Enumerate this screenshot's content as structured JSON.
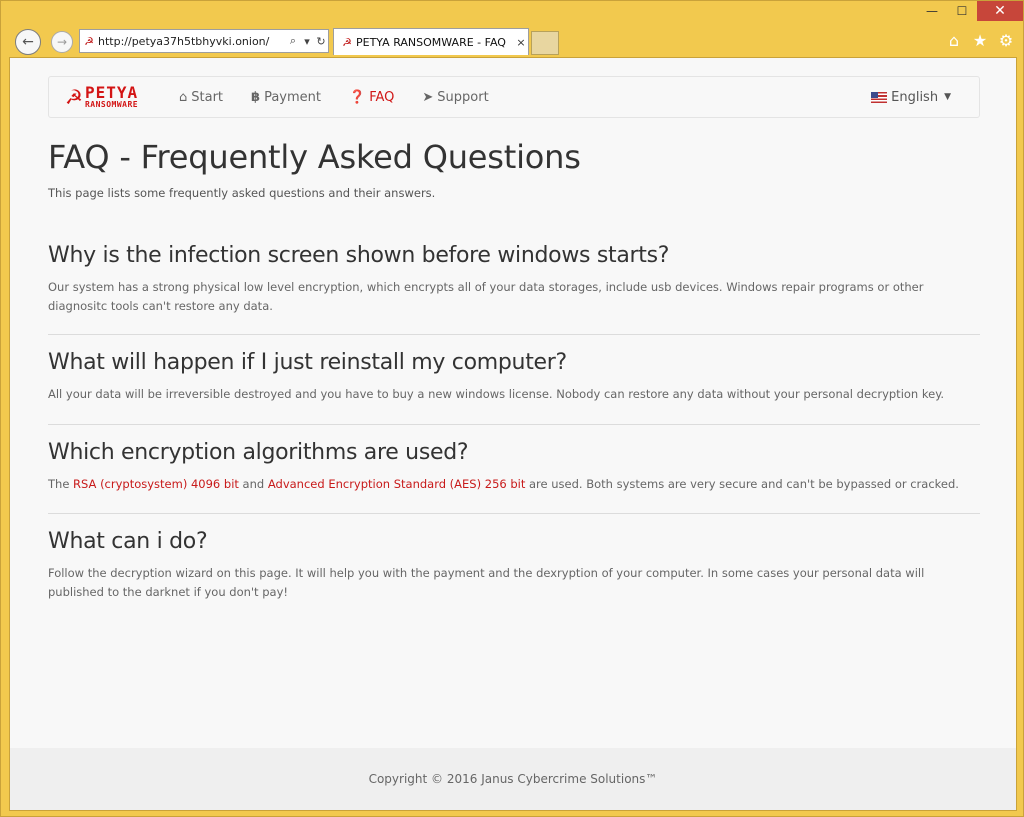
{
  "browser": {
    "address_url": "http://petya37h5tbhyvki.onion/",
    "tab_title": "PETYA RANSOMWARE - FAQ",
    "tab_close": "×",
    "caption": {
      "minimize": "—",
      "maximize": "☐",
      "close": "✕"
    }
  },
  "site": {
    "brand": {
      "line1": "PETYA",
      "line2": "RANSOMWARE"
    },
    "nav": [
      {
        "label": "Start",
        "icon": "home-icon"
      },
      {
        "label": "Payment",
        "icon": "bitcoin-icon"
      },
      {
        "label": "FAQ",
        "icon": "question-circle-icon"
      },
      {
        "label": "Support",
        "icon": "send-icon"
      }
    ],
    "language": "English"
  },
  "page": {
    "title": "FAQ - Frequently Asked Questions",
    "subtitle": "This page lists some frequently asked questions and their answers."
  },
  "faq": [
    {
      "question": "Why is the infection screen shown before windows starts?",
      "answer": "Our system has a strong physical low level encryption, which encrypts all of your data storages, include usb devices. Windows repair programs or other diagnositc tools can't restore any data."
    },
    {
      "question": "What will happen if I just reinstall my computer?",
      "answer": "All your data will be irreversible destroyed and you have to buy a new windows license. Nobody can restore any data without your personal decryption key."
    },
    {
      "question": "Which encryption algorithms are used?",
      "answer_parts": {
        "p1": "The ",
        "link1": "RSA (cryptosystem) 4096 bit",
        "p2": " and ",
        "link2": "Advanced Encryption Standard (AES) 256 bit",
        "p3": " are used. Both systems are very secure and can't be bypassed or cracked."
      }
    },
    {
      "question": "What can i do?",
      "answer": "Follow the decryption wizard on this page. It will help you with the payment and the dexryption of your computer. In some cases your personal data will published to the darknet if you don't pay!"
    }
  ],
  "footer": {
    "copyright": "Copyright © 2016 Janus Cybercrime Solutions™"
  },
  "colors": {
    "accent": "#d01818",
    "frame": "#f2c94e",
    "close": "#c7463a"
  }
}
